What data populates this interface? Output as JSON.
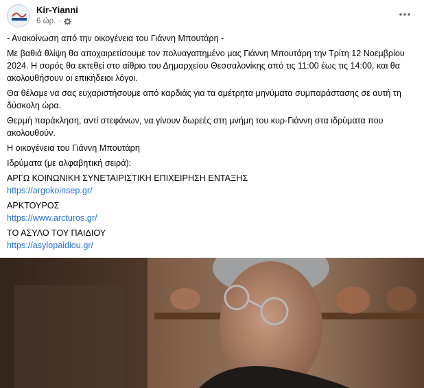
{
  "post": {
    "author": "Kir-Yianni",
    "time": "6 ώρ.",
    "separator": "·",
    "avatar_label": "KIR-YIANNI",
    "privacy_icon": "gear-icon",
    "more_icon": "more-dots-icon"
  },
  "content": {
    "intro": "- Ανακοίνωση από την οικογένεια του Γιάννη Μπουτάρη -",
    "p1": "Με βαθιά θλίψη θα αποχαιρετίσουμε τον πολυαγαπημένο μας Γιάννη Μπουτάρη την Τρίτη 12 Νοεμβρίου 2024. Η σορός θα εκτεθεί στο αίθριο του Δημαρχείου Θεσσαλονίκης από τις 11:00 έως τις 14:00, και θα ακολουθήσουν οι επικήδειοι λόγοι.",
    "p2": "Θα θέλαμε να σας ευχαριστήσουμε από καρδιάς για τα αμέτρητα μηνύματα συμπαράστασης σε αυτή τη δύσκολη ώρα.",
    "p3": "Θερμή παράκληση, αντί στεφάνων, να γίνουν δωρεές στη μνήμη του κυρ-Γιάννη στα ιδρύματα που ακολουθούν.",
    "signature": "Η οικογένεια του Γιάννη Μπουτάρη",
    "foundations_heading": "Ιδρύματα (με αλφαβητική σειρά):",
    "foundations": [
      {
        "name": "ΑΡΓΩ ΚΟΙΝΩΝΙΚΗ ΣΥΝΕΤΑΙΡΙΣΤΙΚΗ ΕΠΙΧΕΙΡΗΣΗ ΕΝΤΑΞΗΣ",
        "url": "https://argokoinsep.gr/"
      },
      {
        "name": "ΑΡΚΤΟΥΡΟΣ",
        "url": "https://www.arcturos.gr/"
      },
      {
        "name": "ΤΟ ΑΣΥΛΟ ΤΟΥ ΠΑΙΔΙΟΥ",
        "url": "https://asylopaidiou.gr/"
      }
    ]
  },
  "colors": {
    "link": "#216fdb",
    "secondary_text": "#65676b",
    "primary_text": "#050505"
  }
}
